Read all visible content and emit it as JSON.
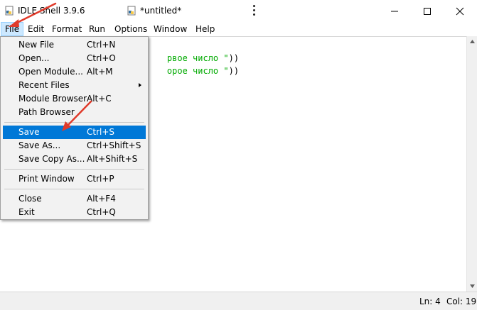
{
  "titlebar": {
    "shell_title": "IDLE Shell 3.9.6",
    "editor_title": "*untitled*"
  },
  "menubar": {
    "items": [
      "File",
      "Edit",
      "Format",
      "Run",
      "Options",
      "Window",
      "Help"
    ]
  },
  "editor": {
    "lines": [
      {
        "green": "рвое число \"",
        "black": "))"
      },
      {
        "green": "орое число \"",
        "black": "))"
      }
    ]
  },
  "file_menu": {
    "items": [
      {
        "label": "New File",
        "accel": "Ctrl+N"
      },
      {
        "label": "Open...",
        "accel": "Ctrl+O"
      },
      {
        "label": "Open Module...",
        "accel": "Alt+M"
      },
      {
        "label": "Recent Files",
        "accel": ""
      },
      {
        "label": "Module Browser",
        "accel": "Alt+C"
      },
      {
        "label": "Path Browser",
        "accel": ""
      },
      {
        "label": "Save",
        "accel": "Ctrl+S"
      },
      {
        "label": "Save As...",
        "accel": "Ctrl+Shift+S"
      },
      {
        "label": "Save Copy As...",
        "accel": "Alt+Shift+S"
      },
      {
        "label": "Print Window",
        "accel": "Ctrl+P"
      },
      {
        "label": "Close",
        "accel": "Alt+F4"
      },
      {
        "label": "Exit",
        "accel": "Ctrl+Q"
      }
    ]
  },
  "statusbar": {
    "line": "Ln: 4",
    "col": "Col: 19"
  },
  "colors": {
    "selected": "#0078d7",
    "annotation_arrow": "#e03a2a",
    "code_string": "#00aa00"
  },
  "icons": [
    "python-file-icon",
    "more-vertical-icon",
    "minimize-icon",
    "maximize-icon",
    "close-icon",
    "submenu-arrow-icon",
    "scroll-up-icon",
    "scroll-down-icon"
  ]
}
